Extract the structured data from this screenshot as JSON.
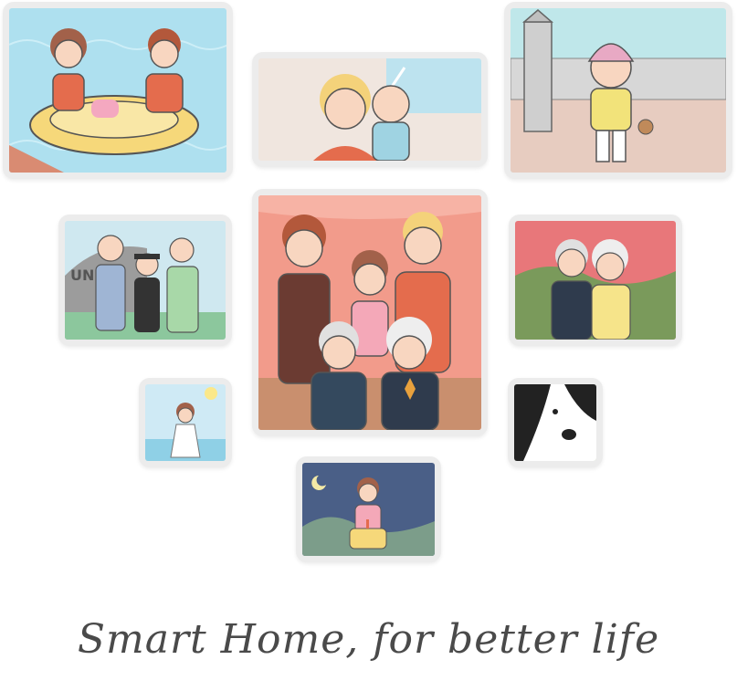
{
  "tagline": "Smart Home, for better life",
  "photos": [
    {
      "scene": "couple-on-boat"
    },
    {
      "scene": "mother-and-baby"
    },
    {
      "scene": "child-with-teddy"
    },
    {
      "scene": "graduation-family",
      "sign_text": "UNI"
    },
    {
      "scene": "family-portrait"
    },
    {
      "scene": "elderly-couple"
    },
    {
      "scene": "girl-at-beach"
    },
    {
      "scene": "dog-closeup"
    },
    {
      "scene": "birthday-cake"
    }
  ]
}
